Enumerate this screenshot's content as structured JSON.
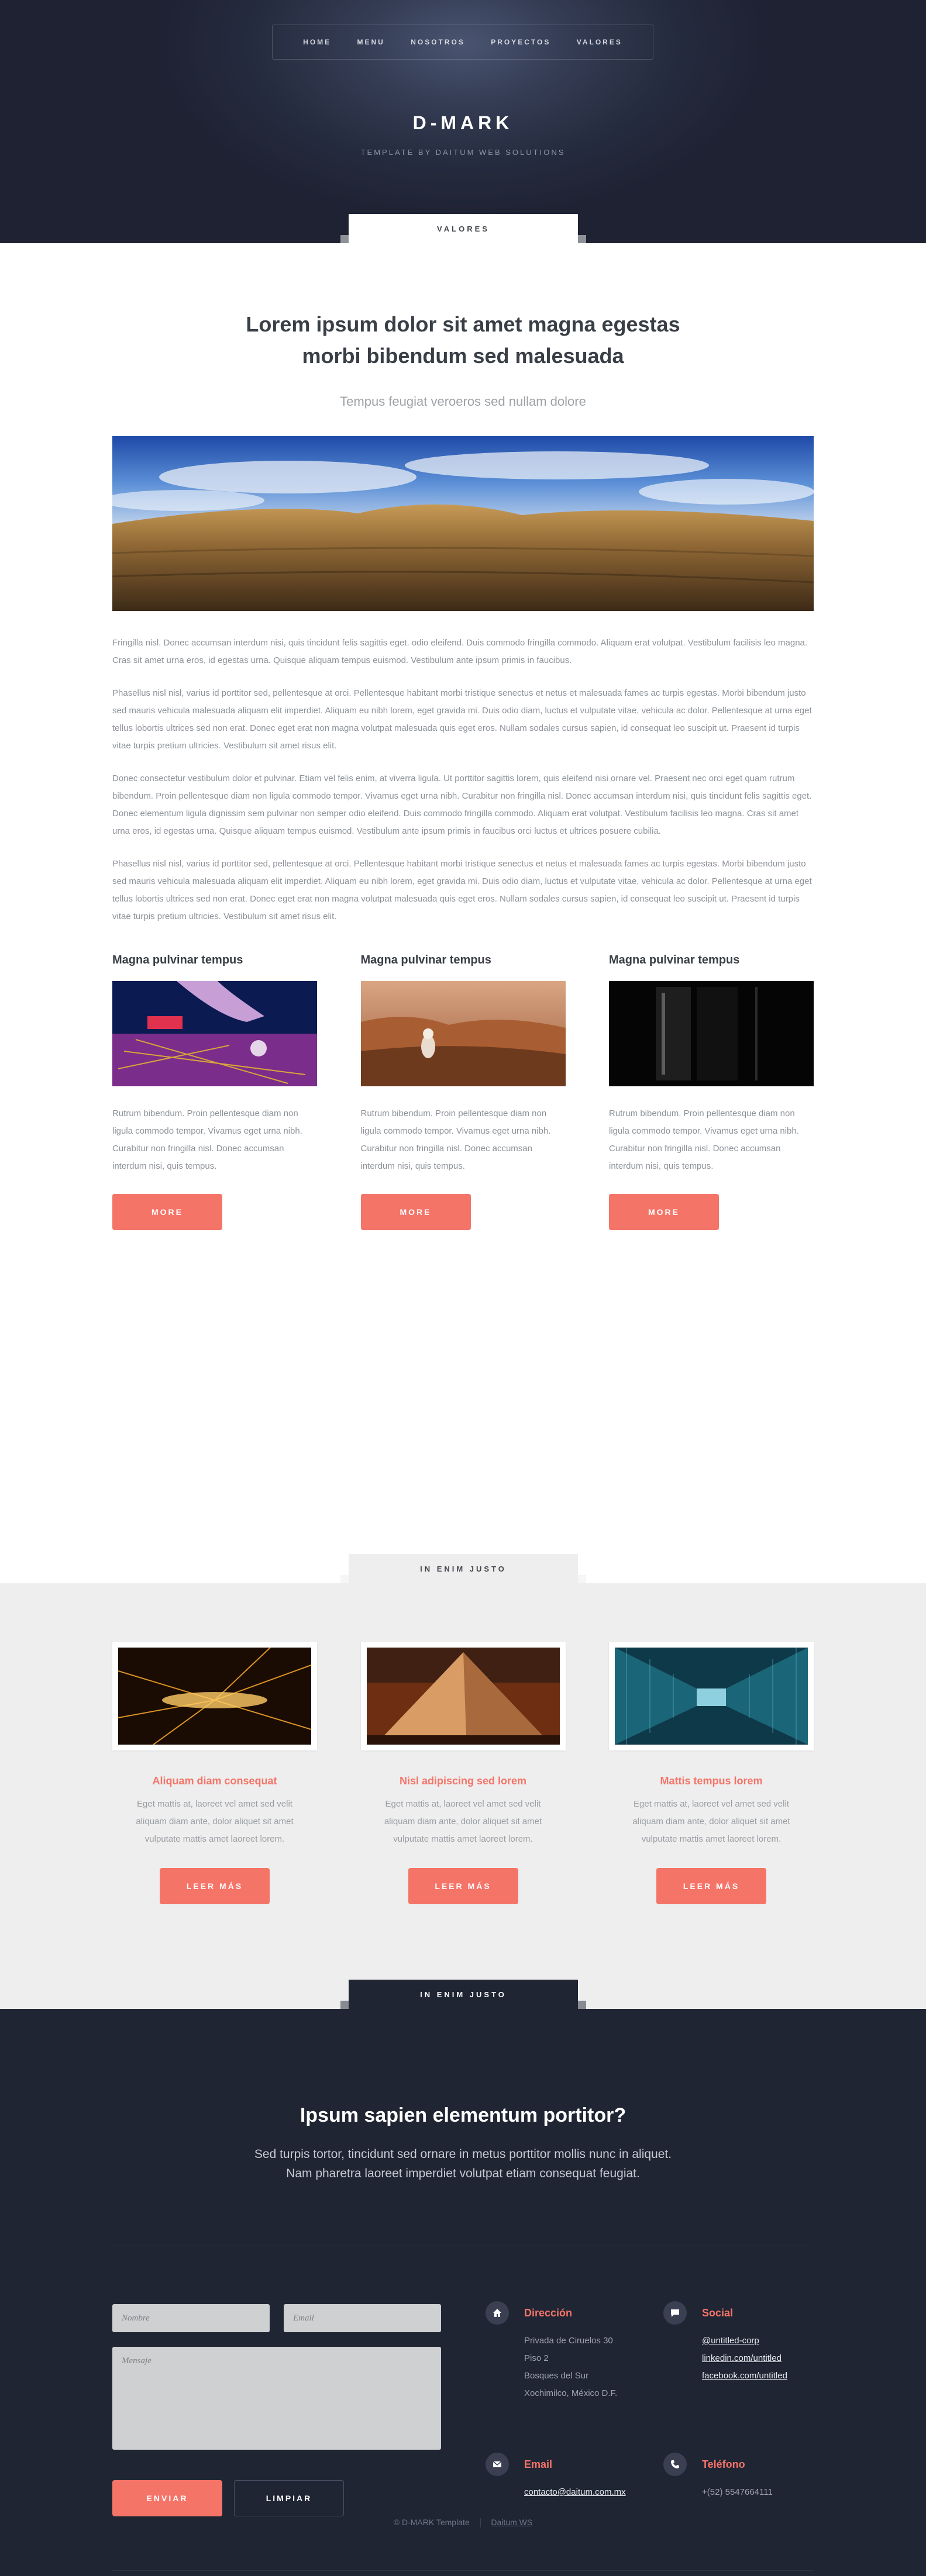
{
  "nav": {
    "items": [
      "HOME",
      "MENU",
      "NOSOTROS",
      "PROYECTOS",
      "VALORES"
    ]
  },
  "hero": {
    "brand": "D-MARK",
    "tagline": "TEMPLATE BY DAITUM WEB SOLUTIONS",
    "tab": "VALORES"
  },
  "main": {
    "title": "Lorem ipsum dolor sit amet magna egestas morbi bibendum sed malesuada",
    "subtitle": "Tempus feugiat veroeros sed nullam dolore",
    "paragraphs": [
      "Fringilla nisl. Donec accumsan interdum nisi, quis tincidunt felis sagittis eget. odio eleifend. Duis commodo fringilla commodo. Aliquam erat volutpat. Vestibulum facilisis leo magna. Cras sit amet urna eros, id egestas urna. Quisque aliquam tempus euismod. Vestibulum ante ipsum primis in faucibus.",
      "Phasellus nisl nisl, varius id porttitor sed, pellentesque at orci. Pellentesque habitant morbi tristique senectus et netus et malesuada fames ac turpis egestas. Morbi bibendum justo sed mauris vehicula malesuada aliquam elit imperdiet. Aliquam eu nibh lorem, eget gravida mi. Duis odio diam, luctus et vulputate vitae, vehicula ac dolor. Pellentesque at urna eget tellus lobortis ultrices sed non erat. Donec eget erat non magna volutpat malesuada quis eget eros. Nullam sodales cursus sapien, id consequat leo suscipit ut. Praesent id turpis vitae turpis pretium ultricies. Vestibulum sit amet risus elit.",
      "Donec consectetur vestibulum dolor et pulvinar. Etiam vel felis enim, at viverra ligula. Ut porttitor sagittis lorem, quis eleifend nisi ornare vel. Praesent nec orci eget quam rutrum bibendum. Proin pellentesque diam non ligula commodo tempor. Vivamus eget urna nibh. Curabitur non fringilla nisl. Donec accumsan interdum nisi, quis tincidunt felis sagittis eget. Donec elementum ligula dignissim sem pulvinar non semper odio eleifend. Duis commodo fringilla commodo. Aliquam erat volutpat. Vestibulum facilisis leo magna. Cras sit amet urna eros, id egestas urna. Quisque aliquam tempus euismod. Vestibulum ante ipsum primis in faucibus orci luctus et ultrices posuere cubilia.",
      "Phasellus nisl nisl, varius id porttitor sed, pellentesque at orci. Pellentesque habitant morbi tristique senectus et netus et malesuada fames ac turpis egestas. Morbi bibendum justo sed mauris vehicula malesuada aliquam elit imperdiet. Aliquam eu nibh lorem, eget gravida mi. Duis odio diam, luctus et vulputate vitae, vehicula ac dolor. Pellentesque at urna eget tellus lobortis ultrices sed non erat. Donec eget erat non magna volutpat malesuada quis eget eros. Nullam sodales cursus sapien, id consequat leo suscipit ut. Praesent id turpis vitae turpis pretium ultricies. Vestibulum sit amet risus elit."
    ],
    "features": [
      {
        "title": "Magna pulvinar tempus",
        "text": "Rutrum bibendum. Proin pellentesque diam non ligula commodo tempor. Vivamus eget urna nibh. Curabitur non fringilla nisl. Donec accumsan interdum nisi, quis tempus.",
        "button": "MORE"
      },
      {
        "title": "Magna pulvinar tempus",
        "text": "Rutrum bibendum. Proin pellentesque diam non ligula commodo tempor. Vivamus eget urna nibh. Curabitur non fringilla nisl. Donec accumsan interdum nisi, quis tempus.",
        "button": "MORE"
      },
      {
        "title": "Magna pulvinar tempus",
        "text": "Rutrum bibendum. Proin pellentesque diam non ligula commodo tempor. Vivamus eget urna nibh. Curabitur non fringilla nisl. Donec accumsan interdum nisi, quis tempus.",
        "button": "MORE"
      }
    ]
  },
  "grey": {
    "tab": "IN ENIM JUSTO",
    "cards": [
      {
        "title": "Aliquam diam consequat",
        "text": "Eget mattis at, laoreet vel amet sed velit aliquam diam ante, dolor aliquet sit amet vulputate mattis amet laoreet lorem.",
        "button": "LEER MÁS"
      },
      {
        "title": "Nisl adipiscing sed lorem",
        "text": "Eget mattis at, laoreet vel amet sed velit aliquam diam ante, dolor aliquet sit amet vulputate mattis amet laoreet lorem.",
        "button": "LEER MÁS"
      },
      {
        "title": "Mattis tempus lorem",
        "text": "Eget mattis at, laoreet vel amet sed velit aliquam diam ante, dolor aliquet sit amet vulputate mattis amet laoreet lorem.",
        "button": "LEER MÁS"
      }
    ]
  },
  "contact": {
    "tab": "IN ENIM JUSTO",
    "title": "Ipsum sapien elementum portitor?",
    "lead1": "Sed turpis tortor, tincidunt sed ornare in metus porttitor mollis nunc in aliquet.",
    "lead2": "Nam pharetra laoreet imperdiet volutpat etiam consequat feugiat.",
    "form": {
      "name_placeholder": "Nombre",
      "email_placeholder": "Email",
      "message_placeholder": "Mensaje",
      "send": "ENVIAR",
      "clear": "LIMPIAR"
    },
    "address": {
      "title": "Dirección",
      "lines": [
        "Privada de Ciruelos 30",
        "Piso 2",
        "Bosques del Sur",
        "Xochimilco, México D.F."
      ]
    },
    "social": {
      "title": "Social",
      "links": [
        "@untitled-corp",
        "linkedin.com/untitled",
        "facebook.com/untitled"
      ]
    },
    "email": {
      "title": "Email",
      "value": "contacto@daitum.com.mx"
    },
    "phone": {
      "title": "Teléfono",
      "value": "+(52) 5547664111"
    }
  },
  "footer": {
    "copyright": "© D-MARK Template",
    "credit": "Daitum WS"
  },
  "colors": {
    "accent": "#f57468",
    "dark": "#202534",
    "grey": "#eeeeee"
  }
}
